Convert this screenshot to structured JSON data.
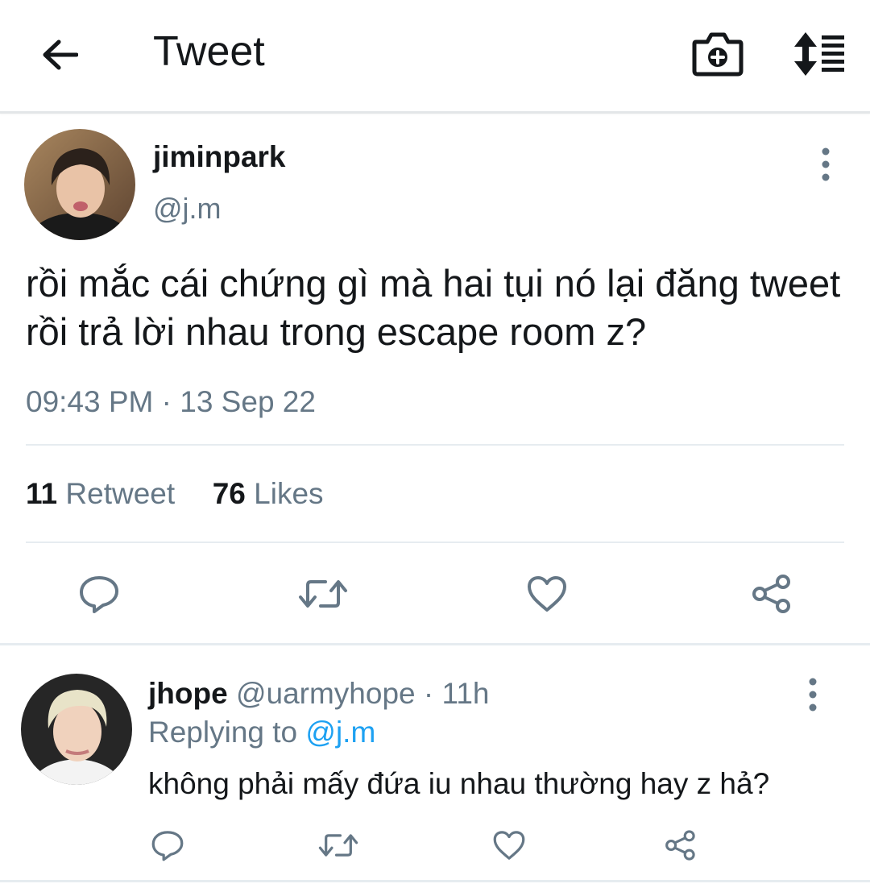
{
  "header": {
    "title": "Tweet",
    "back_icon": "arrow-left-icon",
    "camera_icon": "camera-plus-icon",
    "sort_icon": "sort-list-icon"
  },
  "tweet": {
    "author_name": "jiminpark",
    "author_handle": "@j.m",
    "text": "rồi mắc cái chứng gì mà hai tụi nó lại đăng tweet rồi trả lời nhau trong escape room z?",
    "timestamp": "09:43 PM · 13 Sep 22",
    "retweet_count": "11",
    "retweet_label": "Retweet",
    "likes_count": "76",
    "likes_label": "Likes",
    "actions": [
      "reply-icon",
      "retweet-icon",
      "like-icon",
      "share-icon"
    ]
  },
  "reply": {
    "author_name": "jhope",
    "author_handle": "@uarmyhope",
    "time_separator": "·",
    "time": "11h",
    "replying_prefix": "Replying to",
    "replying_to": "@j.m",
    "text": "không phải mấy đứa iu nhau thường hay z hả?"
  },
  "colors": {
    "text_primary": "#14171a",
    "text_secondary": "#657786",
    "accent": "#1da1f2",
    "divider": "#e6ecf0"
  }
}
